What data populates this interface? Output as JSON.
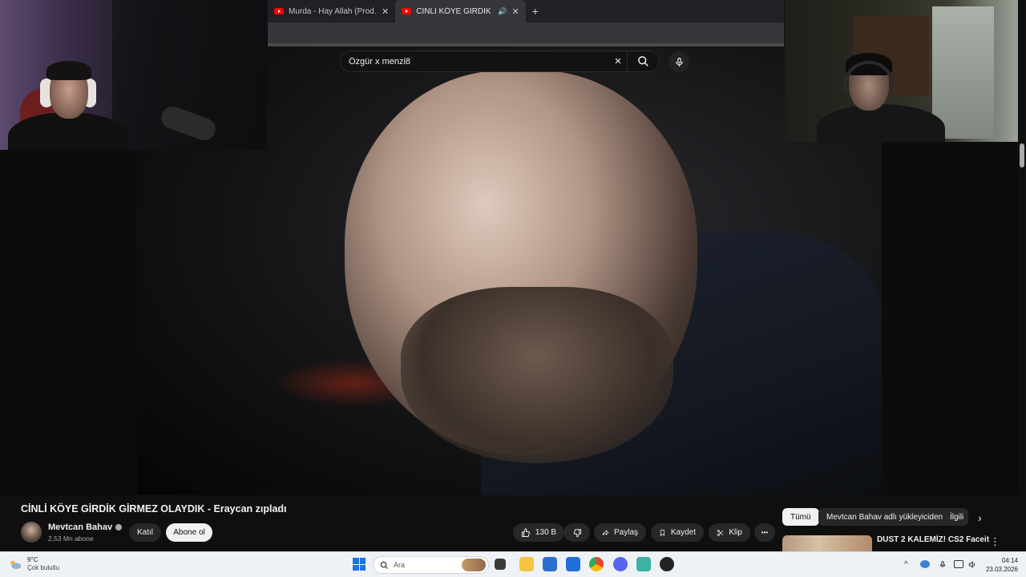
{
  "browser": {
    "tabs": [
      {
        "title": "Murda - Hay Allah (Prod. Vlado",
        "active": false
      },
      {
        "title": "CİNLİ KÖYE GİRDİK GİRMEZ",
        "active": true
      }
    ],
    "new_tab_symbol": "+"
  },
  "search": {
    "value": "Özgür x menzi8",
    "clear_symbol": "×"
  },
  "video": {
    "title": "CİNLİ KÖYE GİRDİK GİRMEZ OLAYDIK - Eraycan zıpladı"
  },
  "channel": {
    "name": "Mevtcan Bahav",
    "subscribers": "2,53 Mn abone",
    "join_label": "Katıl",
    "subscribe_label": "Abone ol"
  },
  "actions": {
    "like_count": "130 B",
    "share_label": "Paylaş",
    "save_label": "Kaydet",
    "clip_label": "Klip",
    "more_symbol": "•••"
  },
  "sidebar": {
    "chips": [
      "Tümü",
      "Mevtcan Bahav adlı yükleyiciden",
      "İlgili"
    ],
    "next_symbol": "›",
    "recommendation": {
      "title": "DUST 2 KALEMİZ! CS2 Faceit",
      "menu_symbol": "⋮"
    }
  },
  "taskbar": {
    "weather_temp": "9°C",
    "weather_desc": "Çok bulutlu",
    "search_placeholder": "Ara",
    "time": "04:14",
    "date": "23.03.2026"
  },
  "colors": {
    "background": "#0f0f0f",
    "chip_active": "#f1f1f1",
    "youtube_red": "#ff0000",
    "taskbar": "#eef1f6"
  }
}
